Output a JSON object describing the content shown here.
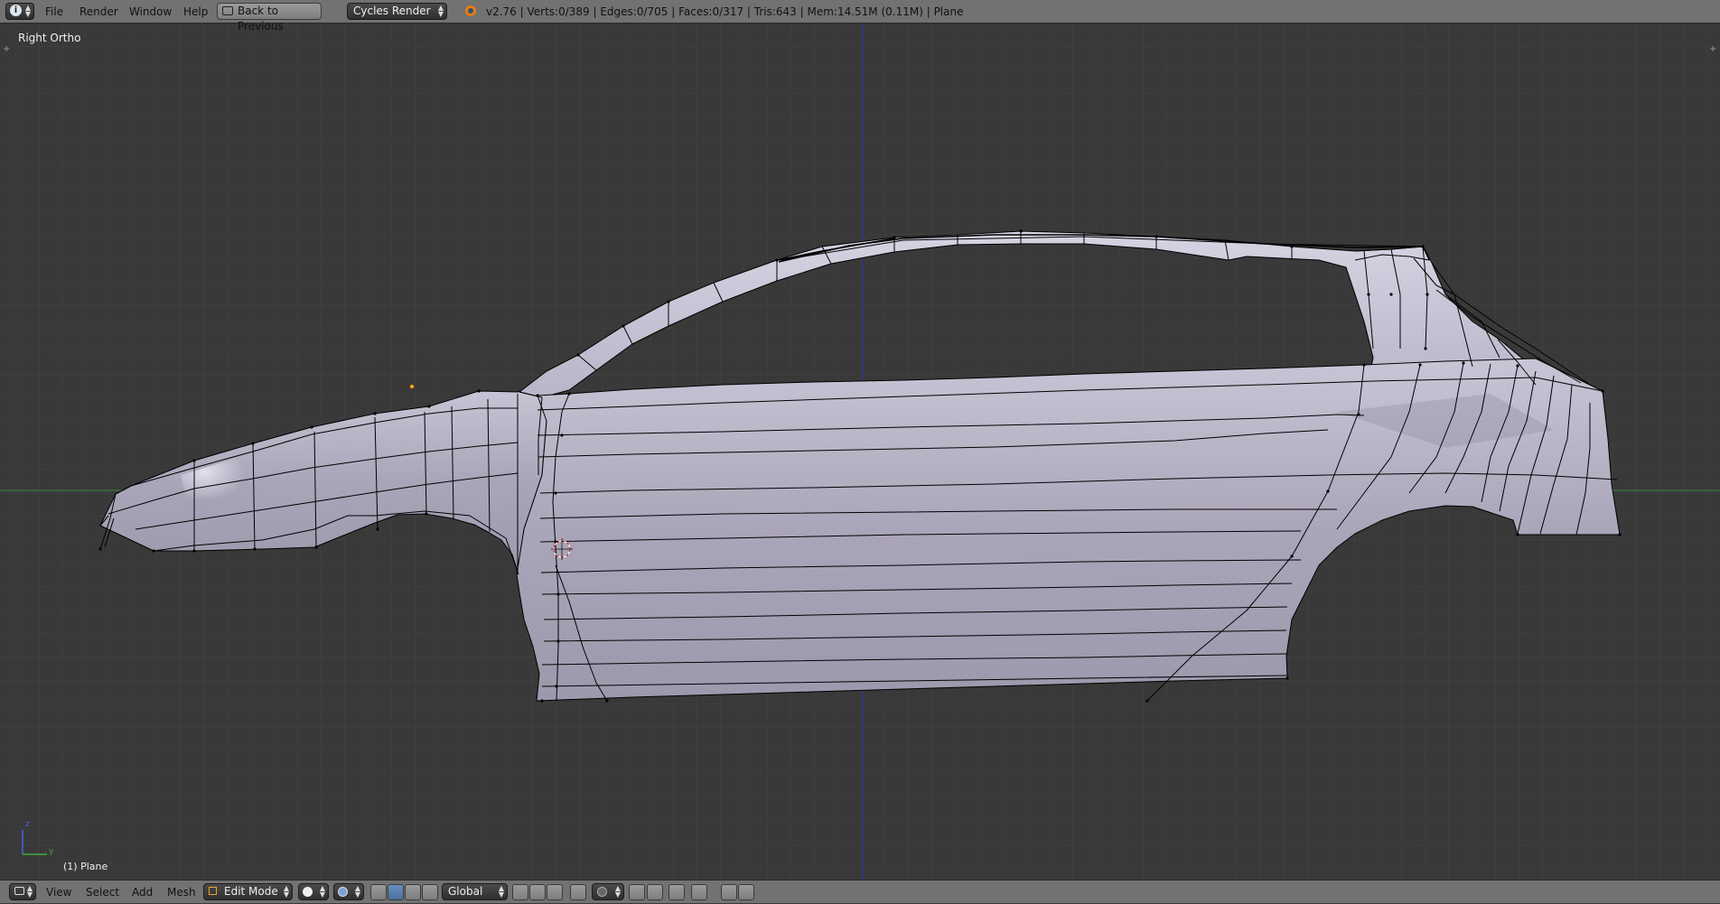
{
  "header": {
    "menu": [
      "File",
      "Render",
      "Window",
      "Help"
    ],
    "back_button": "Back to Previous",
    "render_engine": "Cycles Render",
    "stats": "v2.76 | Verts:0/389 | Edges:0/705 | Faces:0/317 | Tris:643 | Mem:14.51M (0.11M) | Plane"
  },
  "viewport": {
    "view_name": "Right Ortho",
    "object_label": "(1) Plane",
    "axis_labels": {
      "z": "z",
      "y": "y"
    }
  },
  "footer": {
    "menu": [
      "View",
      "Select",
      "Add",
      "Mesh"
    ],
    "mode": "Edit Mode",
    "orientation": "Global"
  },
  "colors": {
    "background": "#393939",
    "grid": "#424242",
    "header": "#727272",
    "y_axis_line": "#2f3fa0",
    "x_axis_line": "#3d8a3d",
    "mesh_face": "#a9a4b7",
    "mesh_edge": "#000000",
    "origin_dot": "#f0a030",
    "cursor": "#cc3333"
  }
}
